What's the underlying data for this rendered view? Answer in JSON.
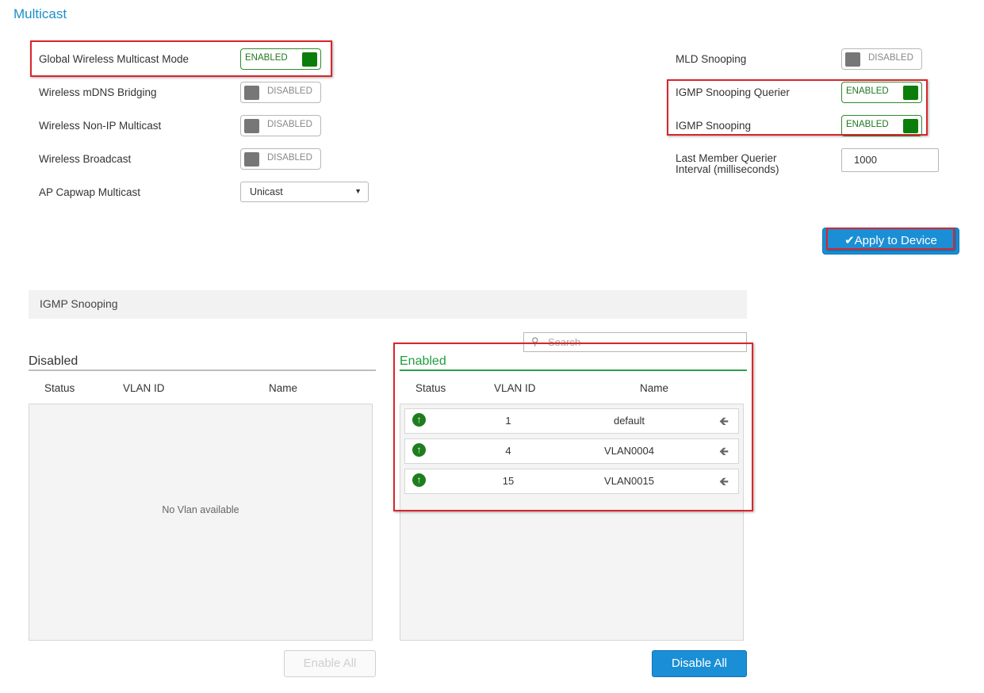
{
  "page": {
    "title": "Multicast"
  },
  "left_settings": [
    {
      "label": "Global Wireless Multicast Mode",
      "state": "ENABLED"
    },
    {
      "label": "Wireless mDNS Bridging",
      "state": "DISABLED"
    },
    {
      "label": "Wireless Non-IP Multicast",
      "state": "DISABLED"
    },
    {
      "label": "Wireless Broadcast",
      "state": "DISABLED"
    }
  ],
  "ap_capwap": {
    "label": "AP Capwap Multicast",
    "value": "Unicast"
  },
  "right_settings": [
    {
      "label": "MLD Snooping",
      "state": "DISABLED"
    },
    {
      "label": "IGMP Snooping Querier",
      "state": "ENABLED"
    },
    {
      "label": "IGMP Snooping",
      "state": "ENABLED"
    }
  ],
  "last_member": {
    "label_line1": "Last Member Querier",
    "label_line2": "Interval (milliseconds)",
    "value": "1000"
  },
  "apply_button": {
    "label": "Apply to Device"
  },
  "igmp_section": {
    "title": "IGMP Snooping"
  },
  "search": {
    "placeholder": "Search"
  },
  "disabled_panel": {
    "title": "Disabled",
    "columns": [
      "Status",
      "VLAN ID",
      "Name"
    ],
    "empty_text": "No Vlan available",
    "button": "Enable All"
  },
  "enabled_panel": {
    "title": "Enabled",
    "columns": [
      "Status",
      "VLAN ID",
      "Name"
    ],
    "rows": [
      {
        "vlan_id": "1",
        "name": "default"
      },
      {
        "vlan_id": "4",
        "name": "VLAN0004"
      },
      {
        "vlan_id": "15",
        "name": "VLAN0015"
      }
    ],
    "button": "Disable All"
  },
  "colors": {
    "accent": "#1a8fd6",
    "title": "#1a8fc9",
    "enabled_green": "#0a7d0a",
    "highlight_red": "#d9262c"
  }
}
